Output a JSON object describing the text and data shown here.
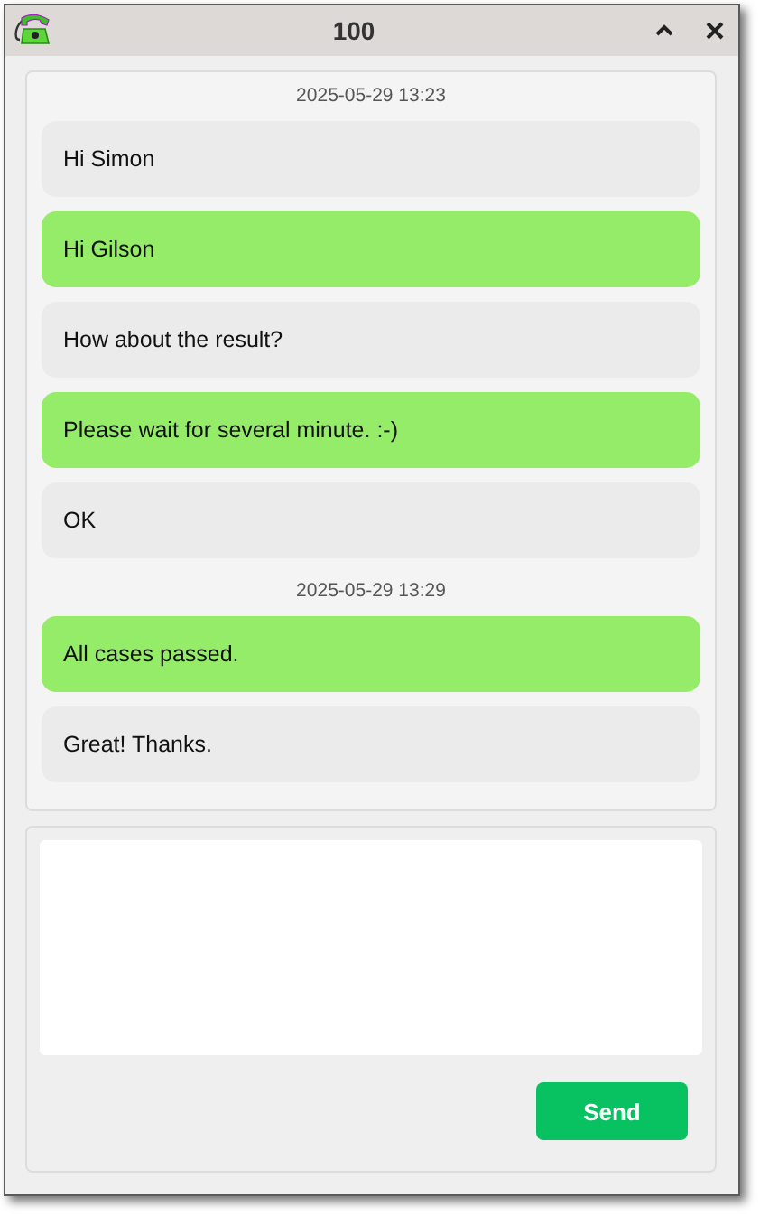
{
  "window": {
    "title": "100"
  },
  "conversation": [
    {
      "kind": "timestamp",
      "text": "2025-05-29 13:23"
    },
    {
      "kind": "incoming",
      "text": "Hi Simon"
    },
    {
      "kind": "outgoing",
      "text": "Hi Gilson"
    },
    {
      "kind": "incoming",
      "text": "How about the result?"
    },
    {
      "kind": "outgoing",
      "text": "Please wait for several minute. :-)"
    },
    {
      "kind": "incoming",
      "text": "OK"
    },
    {
      "kind": "timestamp",
      "text": "2025-05-29 13:29"
    },
    {
      "kind": "outgoing",
      "text": "All cases passed."
    },
    {
      "kind": "incoming",
      "text": "Great! Thanks."
    }
  ],
  "composer": {
    "send_button": "Send"
  }
}
